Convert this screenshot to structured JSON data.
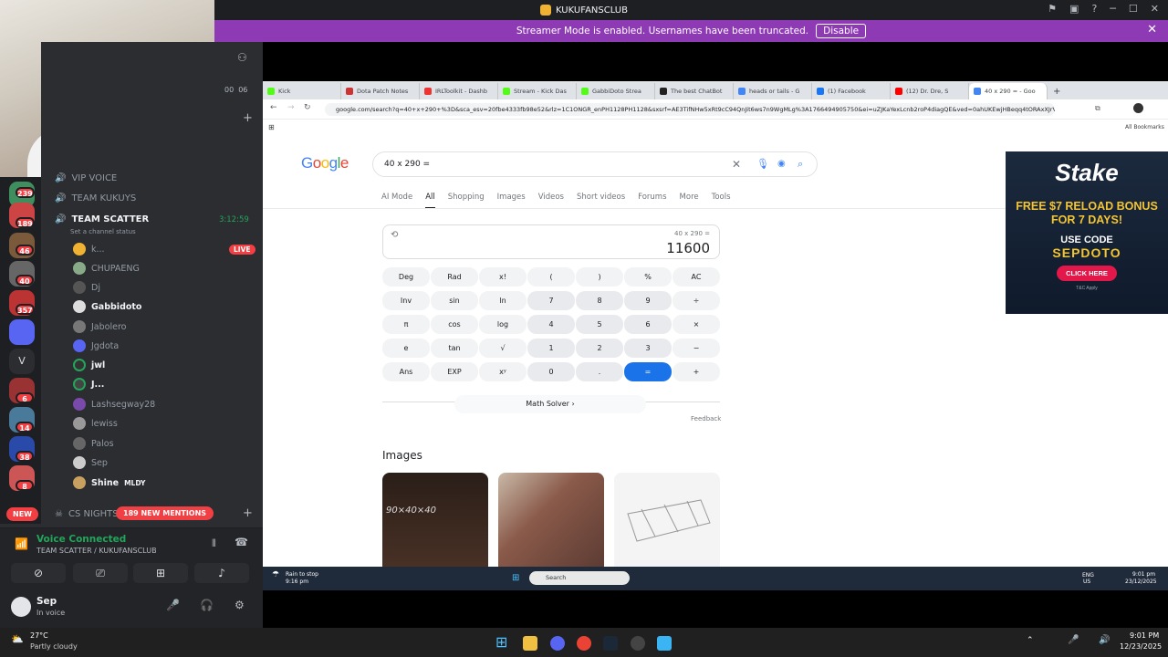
{
  "window": {
    "title": "KUKUFANSCLUB"
  },
  "streamer_banner": {
    "text": "Streamer Mode is enabled. Usernames have been truncated.",
    "button": "Disable"
  },
  "discord": {
    "voice_times": [
      "00",
      "06"
    ],
    "server_badges": [
      "239",
      "189",
      "46",
      "40",
      "357",
      "6",
      "14",
      "38",
      "8"
    ],
    "server_letter": "V",
    "channels": [
      {
        "name": "VIP VOICE"
      },
      {
        "name": "TEAM KUKUYS"
      },
      {
        "name": "TEAM SCATTER",
        "time": "3:12:59",
        "status": "Set a channel status"
      }
    ],
    "members": [
      "k...",
      "CHUPAENG",
      "Dj",
      "Gabbidoto",
      "Jabolero",
      "Jgdota",
      "jwl",
      "J...",
      "Lashsegway28",
      "lewiss",
      "Palos",
      "Sep",
      "Shine",
      "MLDY"
    ],
    "live_label": "LIVE",
    "cs_nights": "CS NIGHTS",
    "mentions": "189 NEW MENTIONS",
    "new_label": "NEW",
    "voice_connected": "Voice Connected",
    "voice_channel": "TEAM SCATTER / KUKUFANSCLUB",
    "user": {
      "name": "Sep",
      "status": "In voice"
    }
  },
  "browser": {
    "tabs": [
      "Kick",
      "Dota Patch Notes",
      "IRLToolkit - Dashb",
      "Stream - Kick Das",
      "GabbiDoto Strea",
      "The best ChatBot",
      "heads or tails - G",
      "(1) Facebook",
      "(12) Dr. Dre, S",
      "40 x 290 = - Goo"
    ],
    "url": "google.com/search?q=40+x+290+%3D&sca_esv=20fbe4333fb98e52&rlz=1C1ONGR_enPH1128PH1128&sxsrf=AE3TifNHw5xRt9cC94QnJit6ws7n9WgMLg%3A1766494905750&ei=uZJKaYexLcnb2roP4diagQE&ved=0ahUKEwjHBeqq4tORAxXJrVY",
    "bookmarks_label": "All Bookmarks"
  },
  "google": {
    "logo": "Google",
    "query": "40 x 290 =",
    "nav": [
      "AI Mode",
      "All",
      "Shopping",
      "Images",
      "Videos",
      "Short videos",
      "Forums",
      "More",
      "Tools"
    ],
    "calc_expression": "40 x 290 =",
    "calc_result": "11600",
    "keys": [
      [
        "Deg",
        "Rad",
        "x!",
        "(",
        ")",
        "%",
        "AC"
      ],
      [
        "Inv",
        "sin",
        "ln",
        "7",
        "8",
        "9",
        "÷"
      ],
      [
        "π",
        "cos",
        "log",
        "4",
        "5",
        "6",
        "×"
      ],
      [
        "e",
        "tan",
        "√",
        "1",
        "2",
        "3",
        "−"
      ],
      [
        "Ans",
        "EXP",
        "xʸ",
        "0",
        ".",
        "=",
        "+"
      ]
    ],
    "math_solver": "Math Solver",
    "feedback": "Feedback",
    "images_heading": "Images",
    "thumb_text": "90×40×40"
  },
  "ad": {
    "brand": "Stake",
    "offer": "FREE $7 RELOAD BONUS FOR 7 DAYS!",
    "code_label": "USE CODE",
    "code": "SEPDOTO",
    "cta": "CLICK HERE",
    "tc": "T&C Apply"
  },
  "inner_taskbar": {
    "weather": "Rain to stop",
    "weather_time": "9:16 pm",
    "search": "Search",
    "lang1": "ENG",
    "lang2": "US",
    "time": "9:01 pm",
    "date": "23/12/2025"
  },
  "taskbar": {
    "temp": "27°C",
    "weather": "Partly cloudy",
    "time": "9:01 PM",
    "date": "12/23/2025"
  }
}
